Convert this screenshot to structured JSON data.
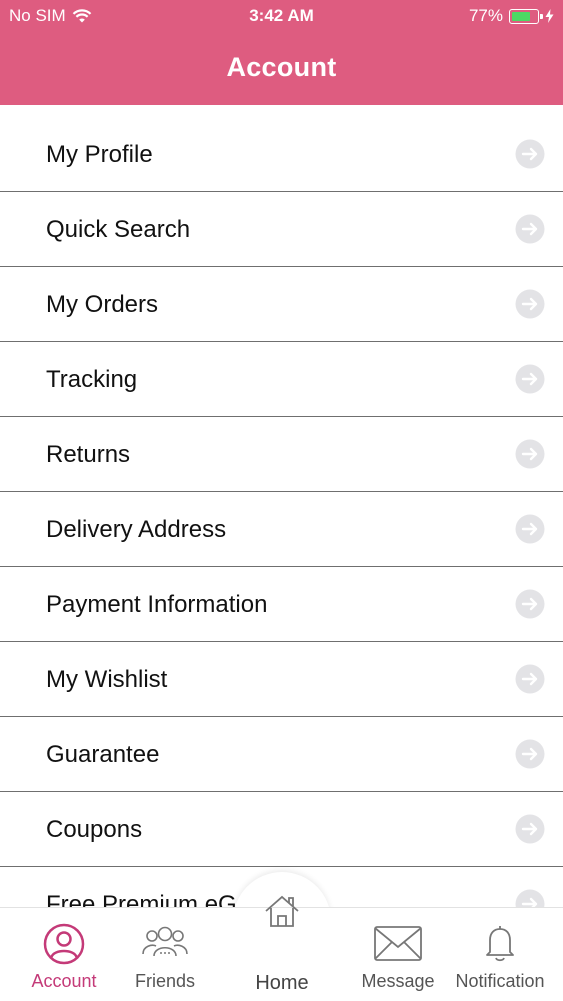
{
  "status_bar": {
    "carrier": "No SIM",
    "time": "3:42 AM",
    "battery": "77%",
    "battery_level": 0.77,
    "battery_color": "#4cd964"
  },
  "header": {
    "title": "Account",
    "color": "#de5c80"
  },
  "menu": {
    "items": [
      {
        "label": "My Profile"
      },
      {
        "label": "Quick Search"
      },
      {
        "label": "My Orders"
      },
      {
        "label": "Tracking"
      },
      {
        "label": "Returns"
      },
      {
        "label": "Delivery Address"
      },
      {
        "label": "Payment Information"
      },
      {
        "label": "My Wishlist"
      },
      {
        "label": "Guarantee"
      },
      {
        "label": "Coupons"
      },
      {
        "label": "Free Premium eG"
      }
    ],
    "arrow_icon": "arrow-right-circle-icon"
  },
  "tabbar": {
    "accent": "#c43a78",
    "tabs": [
      {
        "label": "Account",
        "icon": "user-circle-icon",
        "active": true
      },
      {
        "label": "Friends",
        "icon": "friends-icon",
        "active": false
      },
      {
        "label": "Home",
        "icon": "home-icon",
        "active": false
      },
      {
        "label": "Message",
        "icon": "envelope-icon",
        "active": false
      },
      {
        "label": "Notification",
        "icon": "bell-icon",
        "active": false
      }
    ]
  }
}
